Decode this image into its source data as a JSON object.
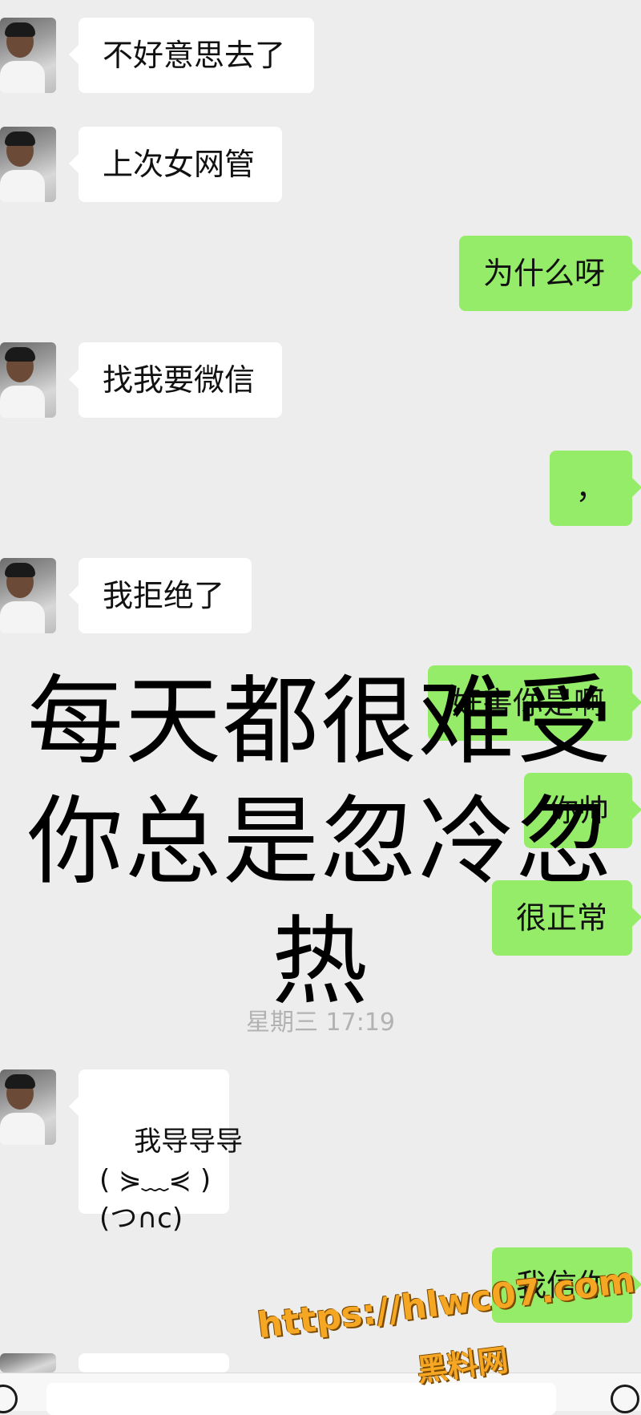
{
  "messages": [
    {
      "side": "left",
      "text": "不好意思去了"
    },
    {
      "side": "left",
      "text": "上次女网管"
    },
    {
      "side": "right",
      "text": "为什么呀"
    },
    {
      "side": "left",
      "text": "找我要微信"
    },
    {
      "side": "right",
      "text": "，"
    },
    {
      "side": "left",
      "text": "我拒绝了"
    },
    {
      "side": "right",
      "text": "好害你是啊"
    },
    {
      "side": "right",
      "text": "你帅"
    },
    {
      "side": "right",
      "text": "很正常"
    },
    {
      "side": "left",
      "text": "我导导导\n( ⋟﹏⋞ )\n(つ∩c)"
    },
    {
      "side": "right",
      "text": "我信你"
    }
  ],
  "timestamp": "星期三 17:19",
  "overlay": {
    "line1": "每天都很难受",
    "line2": "你总是忽冷忽",
    "line3": "热"
  },
  "watermark": {
    "url": "https://hlwc07.com",
    "name": "黑料网"
  },
  "colors": {
    "background": "#ededed",
    "incoming_bubble": "#ffffff",
    "outgoing_bubble": "#95ec69",
    "timestamp": "#b2b2b2",
    "watermark": "#f5a623"
  },
  "icons": {
    "voice": "voice-icon",
    "emoji": "emoji-icon"
  }
}
